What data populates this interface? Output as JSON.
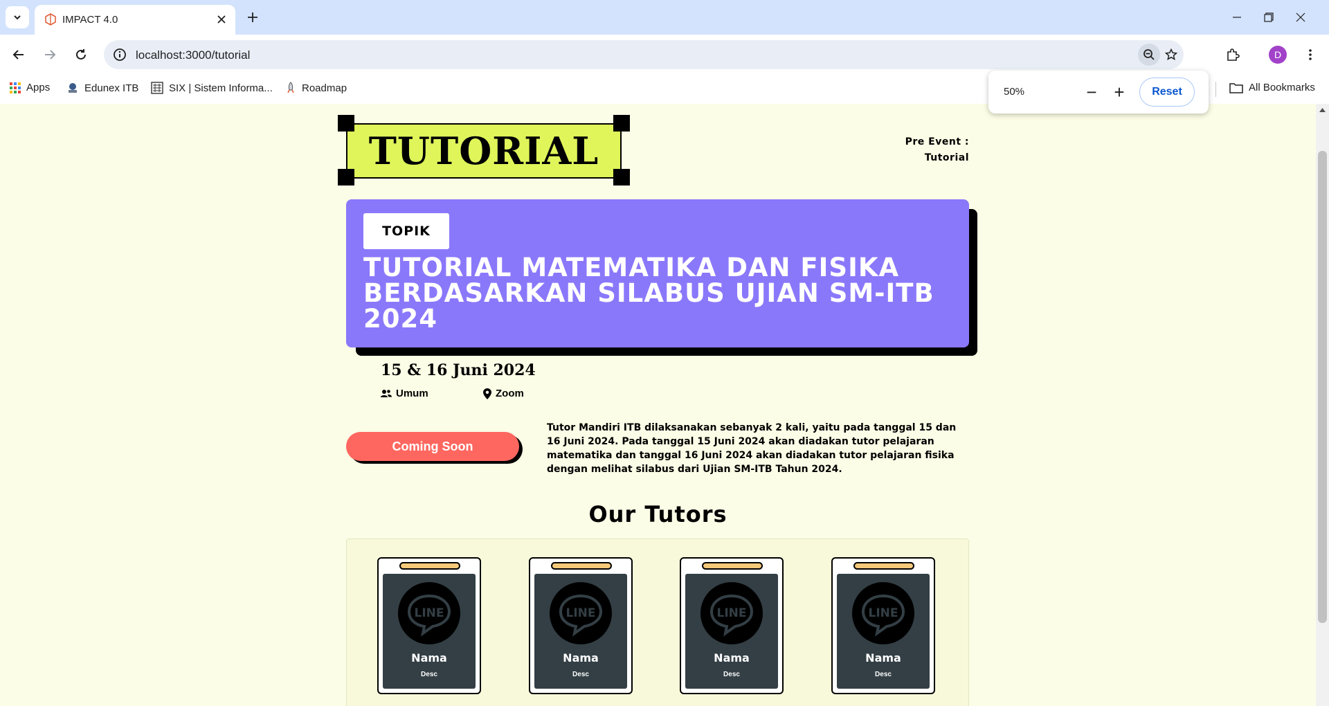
{
  "browser": {
    "tab_title": "IMPACT 4.0",
    "url": "localhost:3000/tutorial",
    "profile_initial": "D",
    "bookmarks": [
      {
        "label": "Apps",
        "icon": "apps-grid-icon"
      },
      {
        "label": "Edunex ITB",
        "icon": "edunex-favicon"
      },
      {
        "label": "SIX | Sistem Informa...",
        "icon": "six-favicon"
      },
      {
        "label": "Roadmap",
        "icon": "rocket-icon"
      }
    ],
    "all_bookmarks_label": "All Bookmarks",
    "zoom_popup": {
      "percent": "50%",
      "minus": "−",
      "plus": "+",
      "reset_label": "Reset"
    }
  },
  "page": {
    "title": "TUTORIAL",
    "pre_event_line1": "Pre Event :",
    "pre_event_line2": "Tutorial",
    "topic_badge": "TOPIK",
    "topic_title": "TUTORIAL MATEMATIKA DAN FISIKA BERDASARKAN SILABUS UJIAN SM-ITB 2024",
    "date": "15 & 16 Juni 2024",
    "audience": "Umum",
    "location": "Zoom",
    "cta_label": "Coming Soon",
    "description": "Tutor Mandiri ITB dilaksanakan sebanyak 2 kali, yaitu pada tanggal 15 dan 16 Juni 2024. Pada tanggal 15 Juni 2024 akan diadakan tutor pelajaran matematika dan tanggal 16 Juni 2024 akan diadakan tutor pelajaran fisika dengan melihat silabus dari Ujian SM-ITB Tahun 2024.",
    "tutors_heading": "Our Tutors",
    "tutors": [
      {
        "name": "Nama",
        "desc": "Desc",
        "logo_text": "LINE"
      },
      {
        "name": "Nama",
        "desc": "Desc",
        "logo_text": "LINE"
      },
      {
        "name": "Nama",
        "desc": "Desc",
        "logo_text": "LINE"
      },
      {
        "name": "Nama",
        "desc": "Desc",
        "logo_text": "LINE"
      }
    ]
  },
  "colors": {
    "page_bg": "#fcfde6",
    "title_bg": "#dff55a",
    "topic_card": "#8a78fb",
    "cta": "#fe675f",
    "tutor_card_inner": "#333f45",
    "tutor_clip": "#f5c97a",
    "browser_tabstrip": "#d3e3fd"
  }
}
